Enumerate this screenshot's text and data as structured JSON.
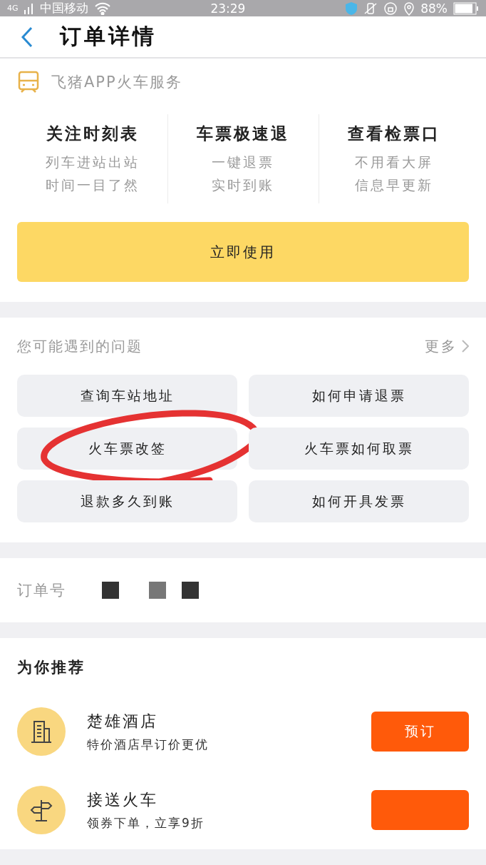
{
  "status_bar": {
    "network": "4G",
    "carrier": "中国移动",
    "time": "23:29",
    "battery": "88%"
  },
  "header": {
    "title": "订单详情"
  },
  "service": {
    "title": "飞猪APP火车服务",
    "features": [
      {
        "title": "关注时刻表",
        "lines": [
          "列车进站出站",
          "时间一目了然"
        ]
      },
      {
        "title": "车票极速退",
        "lines": [
          "一键退票",
          "实时到账"
        ]
      },
      {
        "title": "查看检票口",
        "lines": [
          "不用看大屏",
          "信息早更新"
        ]
      }
    ],
    "button": "立即使用"
  },
  "problems": {
    "title": "您可能遇到的问题",
    "more": "更多",
    "items": [
      {
        "label": "查询车站地址",
        "circled": false
      },
      {
        "label": "如何申请退票",
        "circled": false
      },
      {
        "label": "火车票改签",
        "circled": true
      },
      {
        "label": "火车票如何取票",
        "circled": false
      },
      {
        "label": "退款多久到账",
        "circled": false
      },
      {
        "label": "如何开具发票",
        "circled": false
      }
    ]
  },
  "order": {
    "label": "订单号",
    "redacted": true
  },
  "recommend": {
    "title": "为你推荐",
    "items": [
      {
        "kind": "hotel",
        "name": "楚雄酒店",
        "desc": "特价酒店早订价更优",
        "action": "预订"
      },
      {
        "kind": "transfer",
        "name": "接送火车",
        "desc": "领券下单，立享9折"
      }
    ]
  }
}
